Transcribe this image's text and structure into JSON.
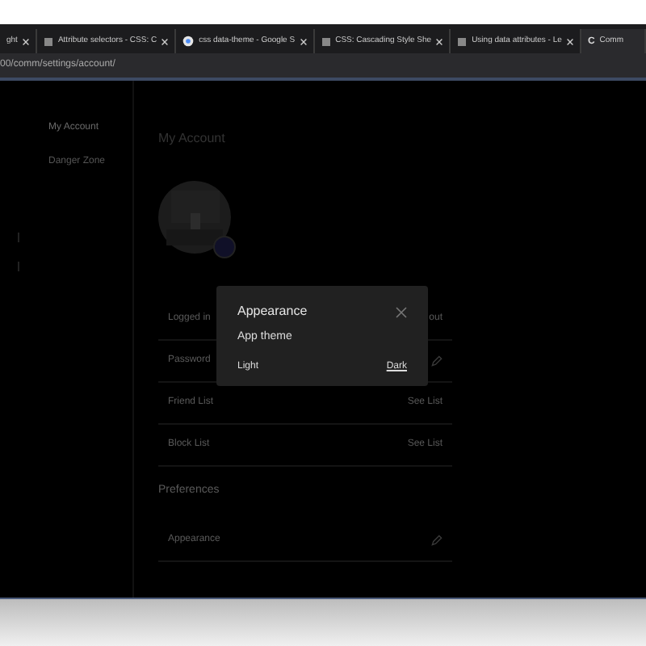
{
  "tabs": [
    {
      "title": "ght",
      "selected": false
    },
    {
      "title": "Attribute selectors - CSS: C",
      "kind": "doc",
      "selected": false
    },
    {
      "title": "css data-theme - Google S",
      "kind": "google",
      "selected": false
    },
    {
      "title": "CSS: Cascading Style She",
      "kind": "doc",
      "selected": false
    },
    {
      "title": "Using data attributes - Le",
      "kind": "doc",
      "selected": false
    },
    {
      "title": "Comm",
      "kind": "letter",
      "letter": "C",
      "selected": true
    }
  ],
  "address_bar": {
    "url": "00/comm/settings/account/"
  },
  "sidebar": {
    "items": [
      {
        "label": "My Account",
        "selected": true
      },
      {
        "label": "Danger Zone",
        "selected": false
      }
    ]
  },
  "page": {
    "title": "My Account",
    "rows": [
      {
        "label": "Logged in",
        "action": "out",
        "kind": "text"
      },
      {
        "label": "Password",
        "kind": "edit"
      },
      {
        "label": "Friend List",
        "action": "See List",
        "kind": "text"
      },
      {
        "label": "Block List",
        "action": "See List",
        "kind": "text"
      }
    ],
    "preferences_title": "Preferences",
    "preference_rows": [
      {
        "label": "Appearance",
        "kind": "edit"
      }
    ]
  },
  "dialog": {
    "title": "Appearance",
    "section": "App theme",
    "options": [
      {
        "label": "Light",
        "selected": false
      },
      {
        "label": "Dark",
        "selected": true
      }
    ]
  }
}
